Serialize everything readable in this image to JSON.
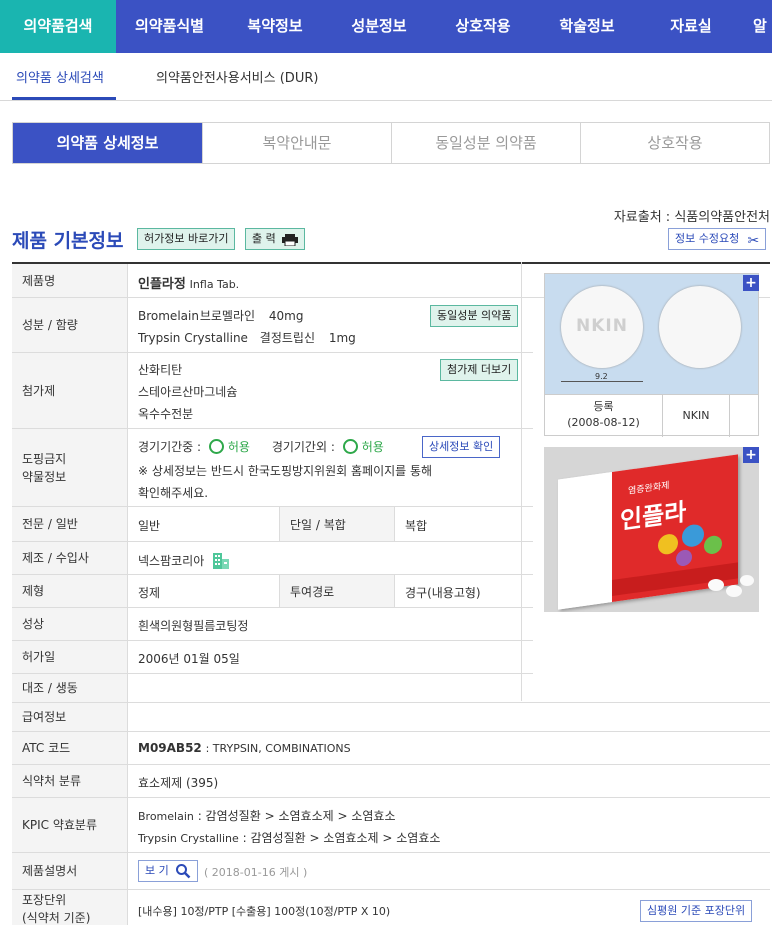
{
  "nav": {
    "items": [
      "의약품검색",
      "의약품식별",
      "복약정보",
      "성분정보",
      "상호작용",
      "학술정보",
      "자료실",
      "알"
    ]
  },
  "subnav": {
    "items": [
      "의약품 상세검색",
      "의약품안전사용서비스 (DUR)"
    ]
  },
  "tabs": [
    "의약품 상세정보",
    "복약안내문",
    "동일성분 의약품",
    "상호작용"
  ],
  "source": "자료출처 : 식품의약품안전처",
  "section": {
    "title": "제품 기본정보",
    "permit_button": "허가정보 바로가기",
    "print_button": "출 력",
    "edit_button": "정보 수정요청"
  },
  "product": {
    "label_name": "제품명",
    "name_ko": "인플라정",
    "name_en": "Infla Tab.",
    "label_ingredient": "성분 / 함량",
    "ingredients": [
      {
        "en": "Bromelain",
        "ko": "브로멜라인",
        "amount": "40mg"
      },
      {
        "en": "Trypsin Crystalline",
        "ko": "결정트립신",
        "amount": "1mg"
      }
    ],
    "same_ingredient_button": "동일성분 의약품",
    "label_additive": "첨가제",
    "additives": [
      "산화티탄",
      "스테아르산마그네슘",
      "옥수수전분"
    ],
    "additive_button": "첨가제 더보기",
    "label_doping": "도핑금지\n약물정보",
    "doping_in_label": "경기기간중 :",
    "doping_in_value": "허용",
    "doping_out_label": "경기기간외 :",
    "doping_out_value": "허용",
    "doping_button": "상세정보 확인",
    "doping_note1": "※ 상세정보는 반드시 한국도핑방지위원회 홈페이지를 통해",
    "doping_note2": "확인해주세요.",
    "label_class": "전문 / 일반",
    "class_value": "일반",
    "label_single": "단일 / 복합",
    "single_value": "복합",
    "label_maker": "제조 / 수입사",
    "maker_value": "넥스팜코리아",
    "label_form": "제형",
    "form_value": "정제",
    "label_route": "투여경로",
    "route_value": "경구(내용고형)",
    "label_appearance": "성상",
    "appearance_value": "흰색의원형필름코팅정",
    "label_date": "허가일",
    "date_value": "2006년 01월 05일",
    "label_compare": "대조 / 생동",
    "label_insurance": "급여정보",
    "label_atc": "ATC 코드",
    "atc_code": "M09AB52",
    "atc_desc": ": TRYPSIN, COMBINATIONS",
    "label_mfds": "식약처 분류",
    "mfds_value": "효소제제 (395)",
    "label_kpic": "KPIC 약효분류",
    "kpic": [
      {
        "name": "Bromelain",
        "path": ": 감염성질환 > 소염효소제 > 소염효소"
      },
      {
        "name": "Trypsin Crystalline",
        "path": ": 감염성질환 > 소염효소제 > 소염효소"
      }
    ],
    "label_manual": "제품설명서",
    "manual_button": "보 기",
    "manual_date": "( 2018-01-16 게시 )",
    "label_package": "포장단위\n(식약처 기준)",
    "package_value": "[내수용] 10정/PTP [수출용] 100정(10정/PTP X 10)",
    "package_button": "심평원 기준 포장단위"
  },
  "pill_image": {
    "mark": "NKIN",
    "size_label": "9.2",
    "status": "등록",
    "status_date": "(2008-08-12)",
    "imprint": "NKIN"
  },
  "package_image": {
    "brand": "인플라",
    "sub": "염증완화제"
  },
  "colors": {
    "nav": "#3b52c4",
    "nav_active": "#1ab5b0",
    "accent": "#2b4ab8",
    "ok": "#2ea84a"
  }
}
